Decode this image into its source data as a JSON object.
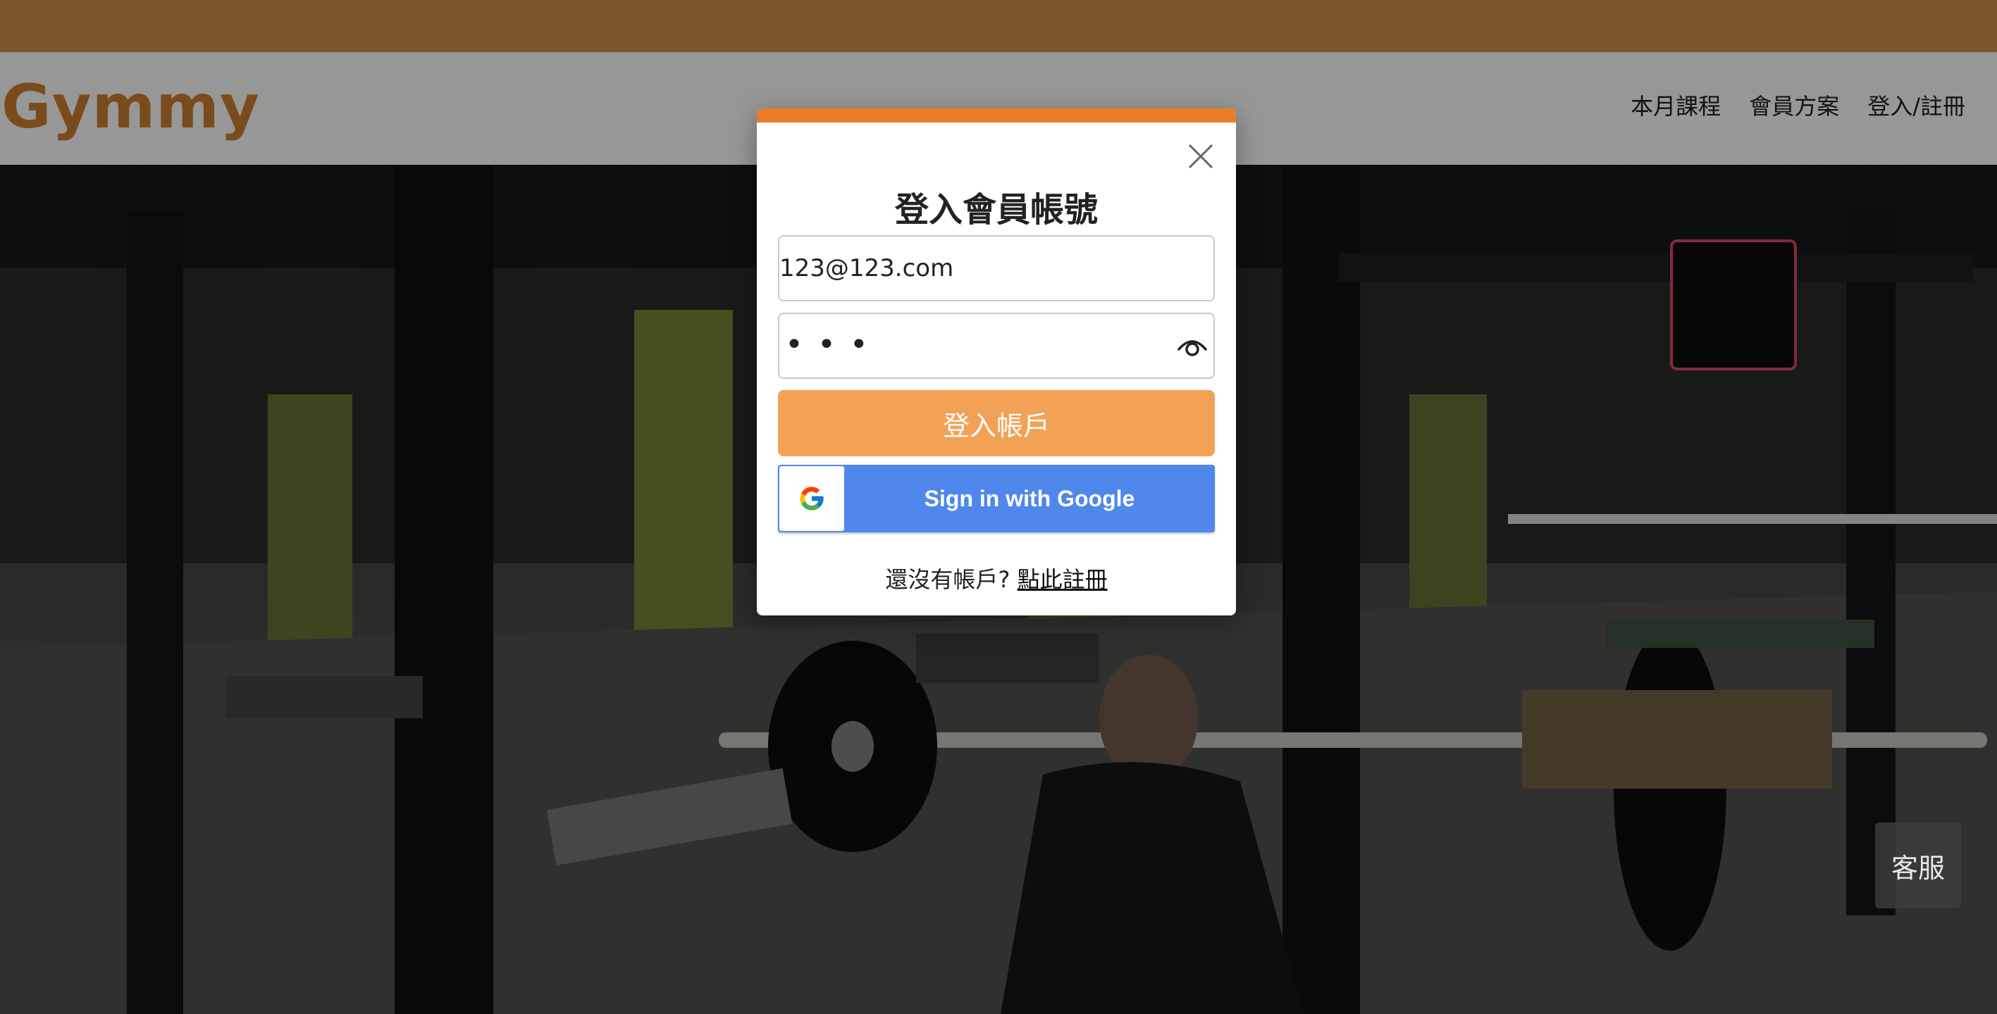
{
  "header": {
    "brand": "Gymmy",
    "nav": [
      "本月課程",
      "會員方案",
      "登入/註冊"
    ]
  },
  "login_modal": {
    "title": "登入會員帳號",
    "email_value": "123@123.com",
    "password_masked": "•••",
    "login_button": "登入帳戶",
    "google_button": "Sign in with Google",
    "register_prompt": "還沒有帳戶?",
    "register_link": "點此註冊"
  },
  "customer_service": "客服",
  "colors": {
    "top_strip": "#7c552d",
    "brand": "#7a4b1d",
    "modal_accent": "#ec7c28",
    "login_button": "#f3a255",
    "google_button": "#4f87ec"
  }
}
